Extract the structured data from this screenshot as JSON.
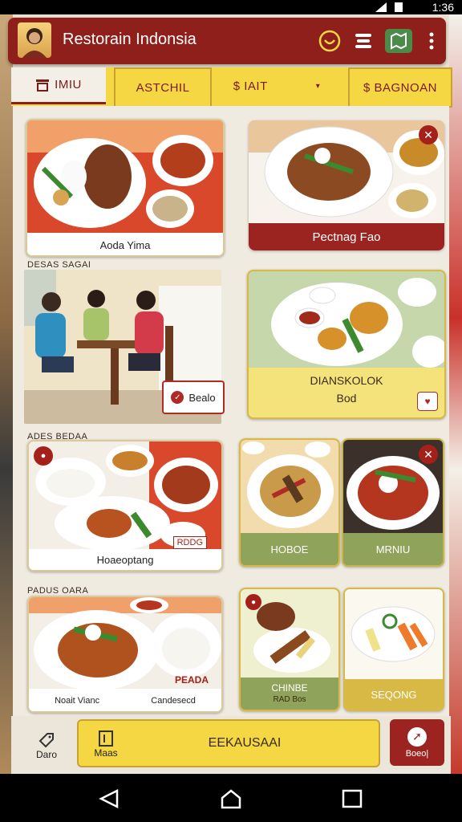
{
  "status_bar": {
    "time": "1:36"
  },
  "app_bar": {
    "title": "Restorain Indonsia",
    "icons": [
      "smile-icon",
      "menu-stack-icon",
      "map-icon",
      "more-vert-icon"
    ]
  },
  "tabs": [
    {
      "label": "IMIU",
      "icon": "receipt-icon"
    },
    {
      "label": "ASTCHIL",
      "icon": ""
    },
    {
      "label": "$ IAIT",
      "icon": ""
    },
    {
      "label": "$ BAGNOAN",
      "icon": ""
    }
  ],
  "cards": {
    "c1": {
      "caption": "Aoda Yima"
    },
    "c2": {
      "caption": "Pectnag Fao"
    },
    "section1": "DESAS SAGAI",
    "dining_button": "Bealo",
    "c3": {
      "title": "DIANSKOLOK",
      "sub": "Bod"
    },
    "section2": "ADES BEDAA",
    "c4": {
      "caption": "Hoaeoptang",
      "tag": "RDDG"
    },
    "c5": {
      "caption": "HOBOE"
    },
    "c6": {
      "caption": "MRNIU"
    },
    "section3": "PADUS OARA",
    "c7": {
      "tag": "PEADA",
      "caption": "Noait Vianc",
      "sub": "Candesecd"
    },
    "c8": {
      "title": "CHINBE",
      "sub": "RAD Bos"
    },
    "c9": {
      "caption": "SEQONG"
    }
  },
  "bottom_bar": {
    "left_label": "Daro",
    "main_icon_label": "Maas",
    "main_label": "EEKAUSAAI",
    "right_label": "Boeo|"
  },
  "colors": {
    "primary": "#8f1f1b",
    "accent": "#f5d643",
    "card_green": "#8fa35a",
    "card_yellow": "#f4e27a"
  }
}
